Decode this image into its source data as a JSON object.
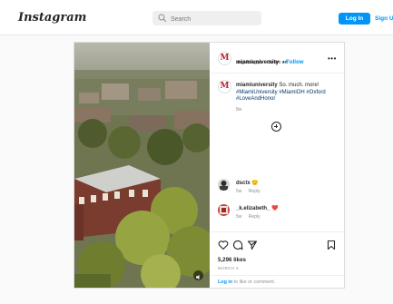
{
  "nav": {
    "logo": "Instagram",
    "search_placeholder": "Search",
    "login_label": "Log In",
    "signup_label": "Sign Up"
  },
  "post": {
    "author": "miamiuniversity",
    "follow_label": "Follow",
    "audio": "angelalopps • dream on",
    "caption_user": "miamiuniversity",
    "caption_text": "So. much. more!",
    "caption_tags": "#MiamiUniversity #MiamiOH #Oxford #LoveAndHonor",
    "caption_time": "8w",
    "comments": [
      {
        "user": "dsctx",
        "emoji": "😌",
        "time": "5w",
        "reply": "Reply"
      },
      {
        "user": "_k.elizabeth_",
        "emoji": "❤️",
        "time": "5w",
        "reply": "Reply"
      }
    ],
    "likes": "5,296 likes",
    "date": "MARCH 4",
    "login_prompt_link": "Log in",
    "login_prompt_text": "to like or comment."
  },
  "colors": {
    "accent": "#0095f6",
    "brand_red": "#b61e2e"
  }
}
